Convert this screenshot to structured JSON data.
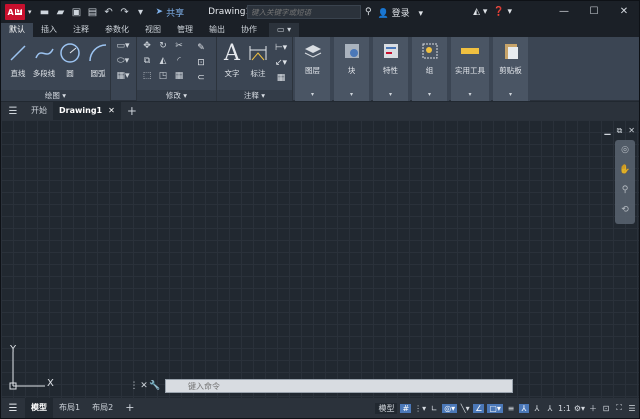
{
  "app": {
    "logo": "A",
    "logo_sub": "LT",
    "doc_title": "Drawing1.d...",
    "share": "共享",
    "search_placeholder": "键入关键字或短语",
    "login": "登录"
  },
  "quick_access": [
    "new-icon",
    "open-icon",
    "save-icon",
    "saveas-icon",
    "undo-icon",
    "redo-icon"
  ],
  "ribbon_tabs": [
    "默认",
    "插入",
    "注释",
    "参数化",
    "视图",
    "管理",
    "输出",
    "协作"
  ],
  "ribbon": {
    "draw_panel": {
      "label": "绘图 ▾",
      "tools": [
        "直线",
        "多段线",
        "圆",
        "圆弧"
      ]
    },
    "modify_panel": {
      "label": "修改 ▾"
    },
    "annotation_panel": {
      "label": "注释 ▾",
      "tools": [
        "文字",
        "标注"
      ]
    },
    "collapsed": [
      "图层",
      "块",
      "特性",
      "组",
      "实用工具",
      "剪贴板"
    ]
  },
  "file_tabs": {
    "start": "开始",
    "current": "Drawing1"
  },
  "ucs": {
    "y": "Y",
    "x": "X"
  },
  "command": {
    "placeholder": "键入命令"
  },
  "layout_tabs": [
    "模型",
    "布局1",
    "布局2"
  ],
  "status": {
    "model": "模型",
    "scale": "1:1"
  },
  "colors": {
    "accent": "#4b78b8",
    "logo": "#c8102e",
    "ribbon": "#3b4553",
    "canvas": "#212830"
  }
}
